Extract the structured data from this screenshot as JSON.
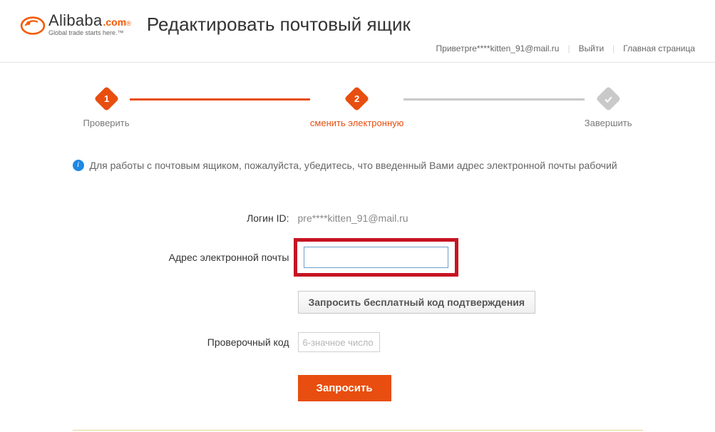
{
  "logo": {
    "brand_main": "Alibaba",
    "brand_suffix": ".com",
    "registered": "®",
    "tagline": "Global trade starts here.™"
  },
  "page_title": "Редактировать почтовый ящик",
  "topbar": {
    "greeting_prefix": "Привет",
    "greeting_email": "pre****kitten_91@mail.ru",
    "logout": "Выйти",
    "home": "Главная страница"
  },
  "steps": {
    "step1": {
      "num": "1",
      "label": "Проверить"
    },
    "step2": {
      "num": "2",
      "label": "сменить электронную"
    },
    "step3": {
      "label": "Завершить"
    }
  },
  "info_text": "Для работы с почтовым ящиком, пожалуйста, убедитесь, что введенный Вами адрес электронной почты рабочий",
  "form": {
    "login_label": "Логин ID:",
    "login_value": "pre****kitten_91@mail.ru",
    "email_label": "Адрес электронной почты",
    "request_code_btn": "Запросить бесплатный код подтверждения",
    "verify_label": "Проверочный код",
    "verify_placeholder": "6-значное число",
    "submit_btn": "Запросить"
  }
}
